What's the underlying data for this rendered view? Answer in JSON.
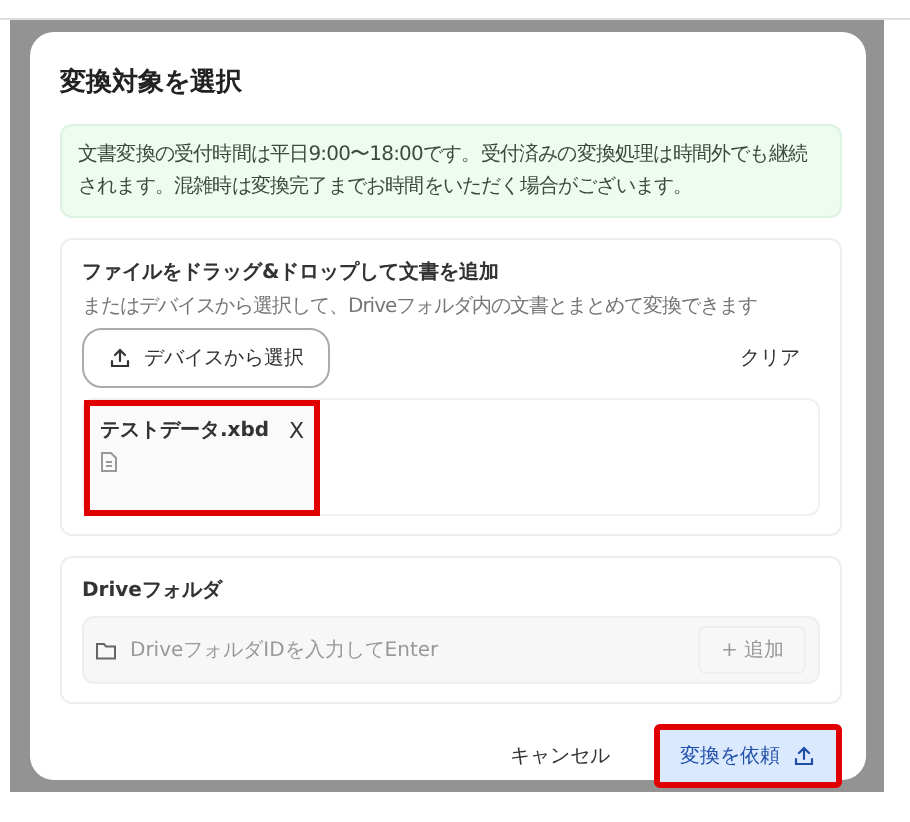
{
  "dialog": {
    "title": "変換対象を選択",
    "notice": "文書変換の受付時間は平日9:00〜18:00です。受付済みの変換処理は時間外でも継続されます。混雑時は変換完了までお時間をいただく場合がございます。",
    "upload": {
      "heading": "ファイルをドラッグ&ドロップして文書を追加",
      "description": "またはデバイスから選択して、Driveフォルダ内の文書とまとめて変換できます",
      "select_button": "デバイスから選択",
      "clear_button": "クリア",
      "files": [
        {
          "name": "テストデータ.xbd",
          "remove": "X",
          "highlighted": true
        }
      ]
    },
    "drive": {
      "heading": "Driveフォルダ",
      "placeholder": "DriveフォルダIDを入力してEnter",
      "add_button": "+ 追加"
    },
    "footer": {
      "cancel": "キャンセル",
      "submit": {
        "label": "変換を依頼",
        "highlighted": true
      }
    }
  }
}
